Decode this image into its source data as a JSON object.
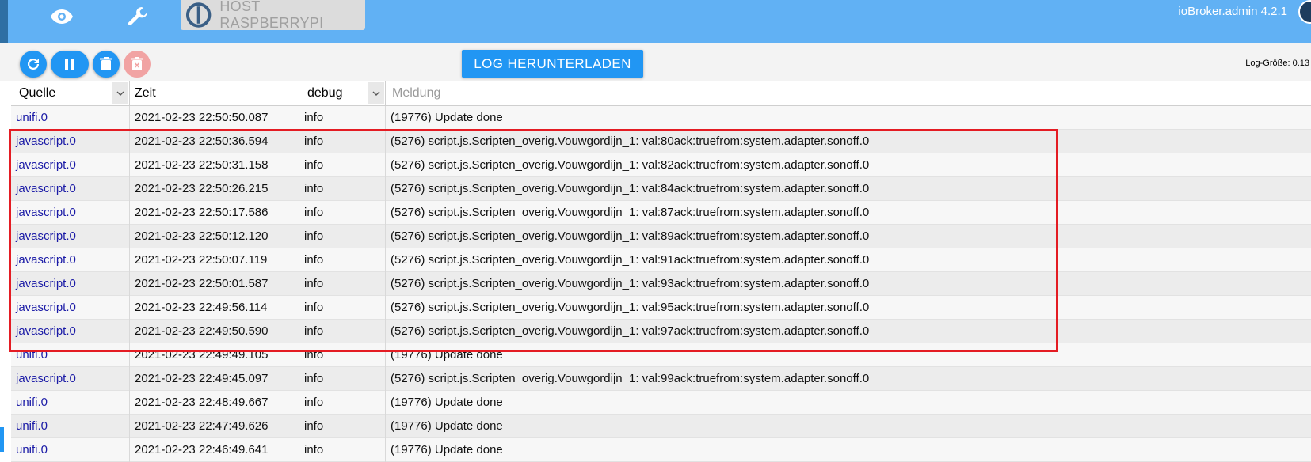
{
  "app": {
    "host_label": "HOST RASPBERRYPI",
    "admin_title": "ioBroker.admin 4.2.1"
  },
  "icons": {
    "eye": "eye-icon",
    "wrench": "wrench-icon",
    "logo": "iobroker-logo",
    "refresh": "refresh-icon",
    "pause": "pause-icon",
    "delete": "trash-icon",
    "delete_all": "trash-x-icon"
  },
  "colors": {
    "topbar": "#61b1f4",
    "accent": "#2196f3",
    "highlight": "#e41c23",
    "source_text": "#1a1aa6"
  },
  "toolbar": {
    "download_label": "LOG HERUNTERLADEN",
    "logsize_label": "Log-Größe: 0.13"
  },
  "table": {
    "source_filter": "Quelle",
    "time_header": "Zeit",
    "severity_filter": "debug",
    "message_placeholder": "Meldung",
    "rows": [
      {
        "source": "unifi.0",
        "time": "2021-02-23 22:50:50.087",
        "severity": "info",
        "message": "(19776) Update done"
      },
      {
        "source": "javascript.0",
        "time": "2021-02-23 22:50:36.594",
        "severity": "info",
        "message": "(5276) script.js.Scripten_overig.Vouwgordijn_1: val:80ack:truefrom:system.adapter.sonoff.0"
      },
      {
        "source": "javascript.0",
        "time": "2021-02-23 22:50:31.158",
        "severity": "info",
        "message": "(5276) script.js.Scripten_overig.Vouwgordijn_1: val:82ack:truefrom:system.adapter.sonoff.0"
      },
      {
        "source": "javascript.0",
        "time": "2021-02-23 22:50:26.215",
        "severity": "info",
        "message": "(5276) script.js.Scripten_overig.Vouwgordijn_1: val:84ack:truefrom:system.adapter.sonoff.0"
      },
      {
        "source": "javascript.0",
        "time": "2021-02-23 22:50:17.586",
        "severity": "info",
        "message": "(5276) script.js.Scripten_overig.Vouwgordijn_1: val:87ack:truefrom:system.adapter.sonoff.0"
      },
      {
        "source": "javascript.0",
        "time": "2021-02-23 22:50:12.120",
        "severity": "info",
        "message": "(5276) script.js.Scripten_overig.Vouwgordijn_1: val:89ack:truefrom:system.adapter.sonoff.0"
      },
      {
        "source": "javascript.0",
        "time": "2021-02-23 22:50:07.119",
        "severity": "info",
        "message": "(5276) script.js.Scripten_overig.Vouwgordijn_1: val:91ack:truefrom:system.adapter.sonoff.0"
      },
      {
        "source": "javascript.0",
        "time": "2021-02-23 22:50:01.587",
        "severity": "info",
        "message": "(5276) script.js.Scripten_overig.Vouwgordijn_1: val:93ack:truefrom:system.adapter.sonoff.0"
      },
      {
        "source": "javascript.0",
        "time": "2021-02-23 22:49:56.114",
        "severity": "info",
        "message": "(5276) script.js.Scripten_overig.Vouwgordijn_1: val:95ack:truefrom:system.adapter.sonoff.0"
      },
      {
        "source": "javascript.0",
        "time": "2021-02-23 22:49:50.590",
        "severity": "info",
        "message": "(5276) script.js.Scripten_overig.Vouwgordijn_1: val:97ack:truefrom:system.adapter.sonoff.0"
      },
      {
        "source": "unifi.0",
        "time": "2021-02-23 22:49:49.105",
        "severity": "info",
        "message": "(19776) Update done"
      },
      {
        "source": "javascript.0",
        "time": "2021-02-23 22:49:45.097",
        "severity": "info",
        "message": "(5276) script.js.Scripten_overig.Vouwgordijn_1: val:99ack:truefrom:system.adapter.sonoff.0"
      },
      {
        "source": "unifi.0",
        "time": "2021-02-23 22:48:49.667",
        "severity": "info",
        "message": "(19776) Update done"
      },
      {
        "source": "unifi.0",
        "time": "2021-02-23 22:47:49.626",
        "severity": "info",
        "message": "(19776) Update done"
      },
      {
        "source": "unifi.0",
        "time": "2021-02-23 22:46:49.641",
        "severity": "info",
        "message": "(19776) Update done"
      }
    ]
  }
}
